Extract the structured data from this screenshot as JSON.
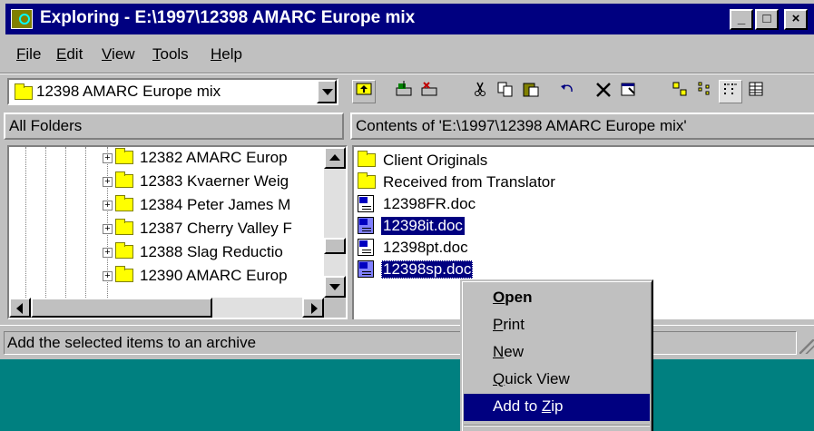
{
  "window": {
    "title": "Exploring - E:\\1997\\12398 AMARC Europe mix",
    "min_glyph": "_",
    "max_glyph": "□",
    "close_glyph": "×"
  },
  "menubar": {
    "items": [
      {
        "label": "File",
        "accel": "F",
        "rest": "ile"
      },
      {
        "label": "Edit",
        "accel": "E",
        "rest": "dit"
      },
      {
        "label": "View",
        "accel": "V",
        "rest": "iew"
      },
      {
        "label": "Tools",
        "accel": "T",
        "rest": "ools"
      },
      {
        "label": "Help",
        "accel": "H",
        "rest": "elp"
      }
    ]
  },
  "address": {
    "value": "12398 AMARC Europe mix"
  },
  "toolbar": {
    "icons": [
      "up-one-level-icon",
      "map-drive-icon",
      "disconnect-drive-icon",
      "cut-icon",
      "copy-icon",
      "paste-icon",
      "undo-icon",
      "delete-icon",
      "properties-icon",
      "large-icons-view-icon",
      "small-icons-view-icon",
      "list-view-icon",
      "details-view-icon"
    ]
  },
  "left_pane": {
    "header": "All Folders",
    "tree_items": [
      {
        "label": "12382 AMARC Europ"
      },
      {
        "label": "12383 Kvaerner Weig"
      },
      {
        "label": "12384 Peter James M"
      },
      {
        "label": "12387 Cherry Valley F"
      },
      {
        "label": "12388 Slag Reductio"
      },
      {
        "label": "12390  AMARC Europ"
      }
    ]
  },
  "right_pane": {
    "header": "Contents of 'E:\\1997\\12398 AMARC Europe mix'",
    "files": [
      {
        "name": "Client Originals",
        "type": "folder",
        "selected": false
      },
      {
        "name": "Received from Translator",
        "type": "folder",
        "selected": false
      },
      {
        "name": "12398FR.doc",
        "type": "doc",
        "selected": false
      },
      {
        "name": "12398it.doc",
        "type": "doc",
        "selected": true
      },
      {
        "name": "12398pt.doc",
        "type": "doc",
        "selected": false
      },
      {
        "name": "12398sp.doc",
        "type": "doc",
        "selected": true
      }
    ]
  },
  "status": {
    "text": "Add the selected items to an archive"
  },
  "context_menu": {
    "items": [
      {
        "label": "Open",
        "accel": "O",
        "rest": "pen",
        "pre": ""
      },
      {
        "label": "Print",
        "accel": "P",
        "rest": "rint",
        "pre": ""
      },
      {
        "label": "New",
        "accel": "N",
        "rest": "ew",
        "pre": ""
      },
      {
        "label": "Quick View",
        "accel": "Q",
        "rest": "uick View",
        "pre": ""
      },
      {
        "label": "Add to Zip",
        "accel": "Z",
        "rest": "ip",
        "pre": "Add to "
      }
    ],
    "highlighted": "Add to Zip"
  },
  "colors": {
    "desktop": "#008080",
    "title_bar": "#000080",
    "selection": "#000080",
    "face": "#c0c0c0"
  }
}
